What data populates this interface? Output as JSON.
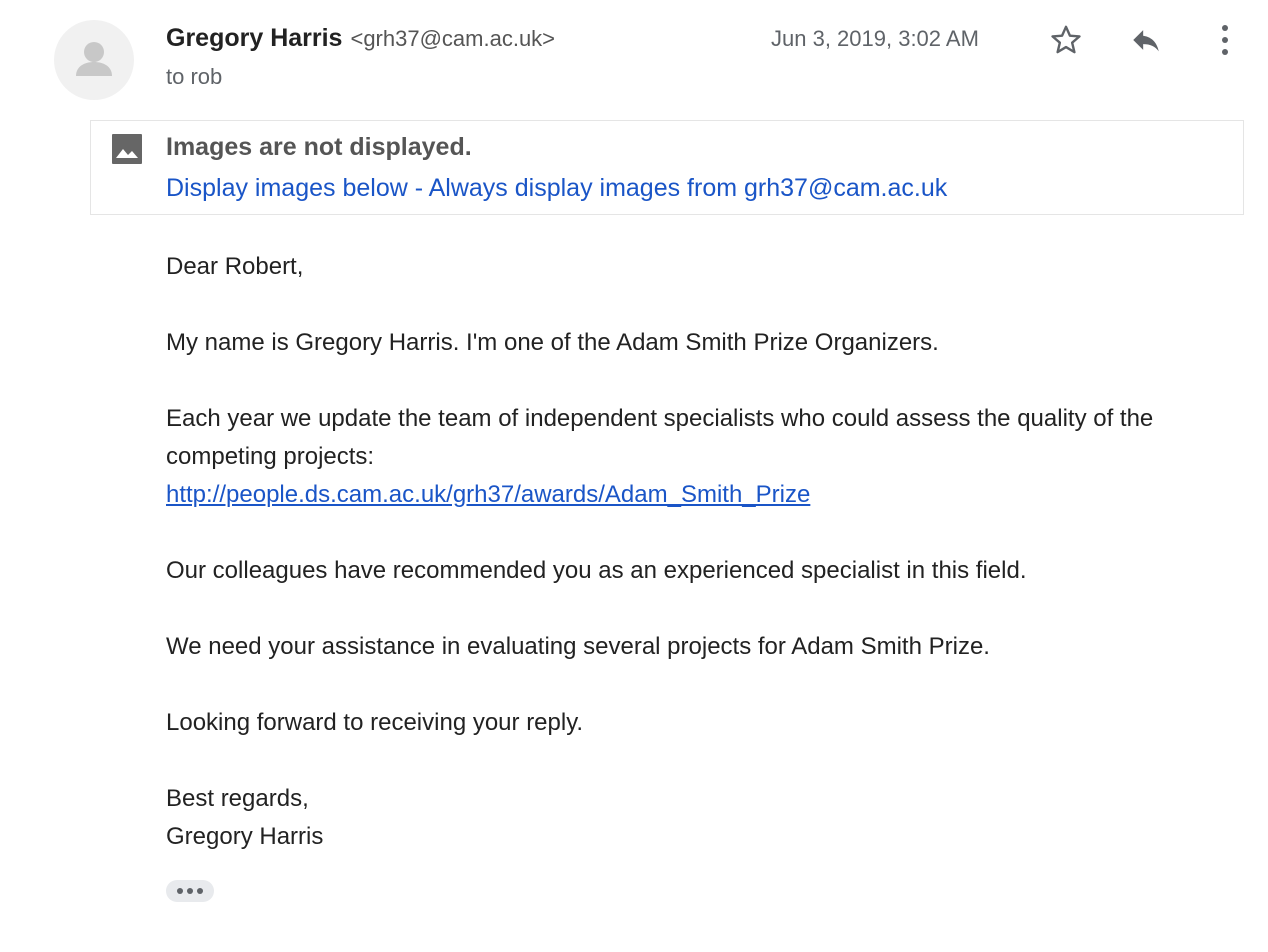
{
  "header": {
    "sender_name": "Gregory Harris",
    "sender_email": "<grh37@cam.ac.uk>",
    "recipient": "to rob",
    "date": "Jun 3, 2019, 3:02 AM",
    "icons": {
      "avatar": "person-icon",
      "star": "star-icon",
      "reply": "reply-icon",
      "more": "more-vert-icon"
    }
  },
  "images_banner": {
    "icon": "image-icon",
    "title": "Images are not displayed.",
    "display_below_link": "Display images below",
    "separator": " - ",
    "always_display_link": "Always display images from grh37@cam.ac.uk"
  },
  "body": {
    "greeting": "Dear Robert,",
    "intro": "My name is Gregory Harris. I'm one of the Adam Smith Prize Organizers.",
    "paragraph_1_line_1": "Each year we update the team of independent specialists who could assess the quality of the",
    "paragraph_1_line_2": "competing projects:",
    "link": "http://people.ds.cam.ac.uk/grh37/awards/Adam_Smith_Prize",
    "paragraph_2": "Our colleagues have recommended you as an experienced specialist in this field.",
    "paragraph_3": "We need your assistance in evaluating several projects for Adam Smith Prize.",
    "paragraph_4": "Looking forward to receiving your reply.",
    "signoff": "Best regards,",
    "signature": "Gregory Harris"
  },
  "trimmed_content": {
    "icon": "ellipsis-icon"
  },
  "colors": {
    "link": "#1a55c7",
    "secondary_text": "#5f6368",
    "primary_text": "#222222"
  }
}
